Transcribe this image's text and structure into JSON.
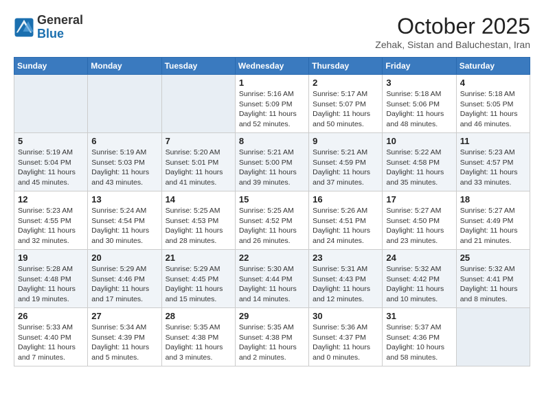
{
  "header": {
    "logo_general": "General",
    "logo_blue": "Blue",
    "month": "October 2025",
    "location": "Zehak, Sistan and Baluchestan, Iran"
  },
  "days_of_week": [
    "Sunday",
    "Monday",
    "Tuesday",
    "Wednesday",
    "Thursday",
    "Friday",
    "Saturday"
  ],
  "weeks": [
    [
      {
        "day": "",
        "info": ""
      },
      {
        "day": "",
        "info": ""
      },
      {
        "day": "",
        "info": ""
      },
      {
        "day": "1",
        "info": "Sunrise: 5:16 AM\nSunset: 5:09 PM\nDaylight: 11 hours\nand 52 minutes."
      },
      {
        "day": "2",
        "info": "Sunrise: 5:17 AM\nSunset: 5:07 PM\nDaylight: 11 hours\nand 50 minutes."
      },
      {
        "day": "3",
        "info": "Sunrise: 5:18 AM\nSunset: 5:06 PM\nDaylight: 11 hours\nand 48 minutes."
      },
      {
        "day": "4",
        "info": "Sunrise: 5:18 AM\nSunset: 5:05 PM\nDaylight: 11 hours\nand 46 minutes."
      }
    ],
    [
      {
        "day": "5",
        "info": "Sunrise: 5:19 AM\nSunset: 5:04 PM\nDaylight: 11 hours\nand 45 minutes."
      },
      {
        "day": "6",
        "info": "Sunrise: 5:19 AM\nSunset: 5:03 PM\nDaylight: 11 hours\nand 43 minutes."
      },
      {
        "day": "7",
        "info": "Sunrise: 5:20 AM\nSunset: 5:01 PM\nDaylight: 11 hours\nand 41 minutes."
      },
      {
        "day": "8",
        "info": "Sunrise: 5:21 AM\nSunset: 5:00 PM\nDaylight: 11 hours\nand 39 minutes."
      },
      {
        "day": "9",
        "info": "Sunrise: 5:21 AM\nSunset: 4:59 PM\nDaylight: 11 hours\nand 37 minutes."
      },
      {
        "day": "10",
        "info": "Sunrise: 5:22 AM\nSunset: 4:58 PM\nDaylight: 11 hours\nand 35 minutes."
      },
      {
        "day": "11",
        "info": "Sunrise: 5:23 AM\nSunset: 4:57 PM\nDaylight: 11 hours\nand 33 minutes."
      }
    ],
    [
      {
        "day": "12",
        "info": "Sunrise: 5:23 AM\nSunset: 4:55 PM\nDaylight: 11 hours\nand 32 minutes."
      },
      {
        "day": "13",
        "info": "Sunrise: 5:24 AM\nSunset: 4:54 PM\nDaylight: 11 hours\nand 30 minutes."
      },
      {
        "day": "14",
        "info": "Sunrise: 5:25 AM\nSunset: 4:53 PM\nDaylight: 11 hours\nand 28 minutes."
      },
      {
        "day": "15",
        "info": "Sunrise: 5:25 AM\nSunset: 4:52 PM\nDaylight: 11 hours\nand 26 minutes."
      },
      {
        "day": "16",
        "info": "Sunrise: 5:26 AM\nSunset: 4:51 PM\nDaylight: 11 hours\nand 24 minutes."
      },
      {
        "day": "17",
        "info": "Sunrise: 5:27 AM\nSunset: 4:50 PM\nDaylight: 11 hours\nand 23 minutes."
      },
      {
        "day": "18",
        "info": "Sunrise: 5:27 AM\nSunset: 4:49 PM\nDaylight: 11 hours\nand 21 minutes."
      }
    ],
    [
      {
        "day": "19",
        "info": "Sunrise: 5:28 AM\nSunset: 4:48 PM\nDaylight: 11 hours\nand 19 minutes."
      },
      {
        "day": "20",
        "info": "Sunrise: 5:29 AM\nSunset: 4:46 PM\nDaylight: 11 hours\nand 17 minutes."
      },
      {
        "day": "21",
        "info": "Sunrise: 5:29 AM\nSunset: 4:45 PM\nDaylight: 11 hours\nand 15 minutes."
      },
      {
        "day": "22",
        "info": "Sunrise: 5:30 AM\nSunset: 4:44 PM\nDaylight: 11 hours\nand 14 minutes."
      },
      {
        "day": "23",
        "info": "Sunrise: 5:31 AM\nSunset: 4:43 PM\nDaylight: 11 hours\nand 12 minutes."
      },
      {
        "day": "24",
        "info": "Sunrise: 5:32 AM\nSunset: 4:42 PM\nDaylight: 11 hours\nand 10 minutes."
      },
      {
        "day": "25",
        "info": "Sunrise: 5:32 AM\nSunset: 4:41 PM\nDaylight: 11 hours\nand 8 minutes."
      }
    ],
    [
      {
        "day": "26",
        "info": "Sunrise: 5:33 AM\nSunset: 4:40 PM\nDaylight: 11 hours\nand 7 minutes."
      },
      {
        "day": "27",
        "info": "Sunrise: 5:34 AM\nSunset: 4:39 PM\nDaylight: 11 hours\nand 5 minutes."
      },
      {
        "day": "28",
        "info": "Sunrise: 5:35 AM\nSunset: 4:38 PM\nDaylight: 11 hours\nand 3 minutes."
      },
      {
        "day": "29",
        "info": "Sunrise: 5:35 AM\nSunset: 4:38 PM\nDaylight: 11 hours\nand 2 minutes."
      },
      {
        "day": "30",
        "info": "Sunrise: 5:36 AM\nSunset: 4:37 PM\nDaylight: 11 hours\nand 0 minutes."
      },
      {
        "day": "31",
        "info": "Sunrise: 5:37 AM\nSunset: 4:36 PM\nDaylight: 10 hours\nand 58 minutes."
      },
      {
        "day": "",
        "info": ""
      }
    ]
  ]
}
